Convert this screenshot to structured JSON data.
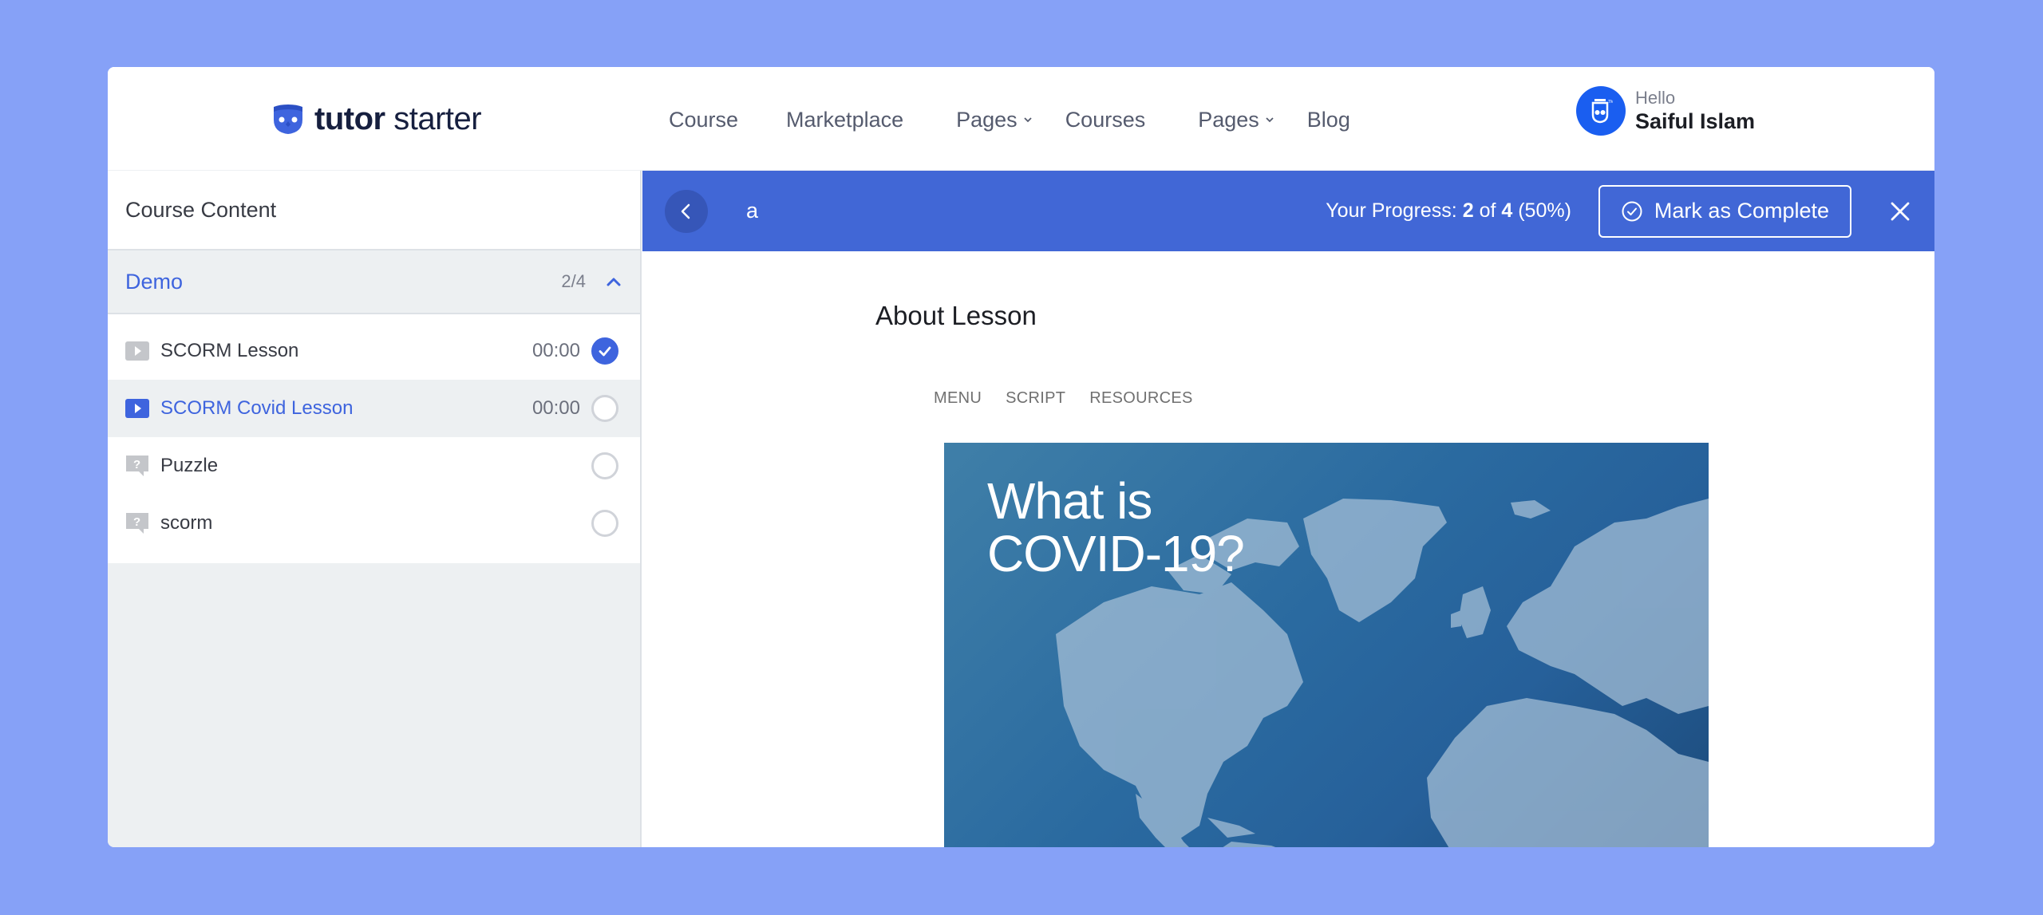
{
  "brand": {
    "name_bold": "tutor",
    "name_light": "starter",
    "accent": "#3e64de",
    "logo_icon": "owl-logo-icon"
  },
  "nav": {
    "items": [
      {
        "label": "Course",
        "dropdown": false
      },
      {
        "label": "Marketplace",
        "dropdown": false
      },
      {
        "label": "Pages",
        "dropdown": true
      },
      {
        "label": "Courses",
        "dropdown": false
      },
      {
        "label": "Pages",
        "dropdown": true
      },
      {
        "label": "Blog",
        "dropdown": false
      }
    ]
  },
  "user": {
    "greeting": "Hello",
    "name": "Saiful Islam"
  },
  "sidebar": {
    "title": "Course Content",
    "topic": {
      "title": "Demo",
      "count": "2/4",
      "expanded": true
    },
    "lessons": [
      {
        "title": "SCORM Lesson",
        "type": "video",
        "time": "00:00",
        "completed": true,
        "active": false
      },
      {
        "title": "SCORM Covid Lesson",
        "type": "video",
        "time": "00:00",
        "completed": false,
        "active": true
      },
      {
        "title": "Puzzle",
        "type": "quiz",
        "time": "",
        "completed": false,
        "active": false
      },
      {
        "title": "scorm",
        "type": "quiz",
        "time": "",
        "completed": false,
        "active": false
      }
    ]
  },
  "topbar": {
    "lesson_name": "a",
    "progress_label": "Your Progress:",
    "progress_done": "2",
    "progress_of": "of",
    "progress_total": "4",
    "progress_percent": "(50%)",
    "mark_complete_label": "Mark as Complete",
    "color": "#4167d6"
  },
  "content": {
    "heading": "About Lesson",
    "scorm_tabs": [
      "MENU",
      "SCRIPT",
      "RESOURCES"
    ],
    "slide_title_line1": "What is",
    "slide_title_line2": "COVID-19?"
  }
}
